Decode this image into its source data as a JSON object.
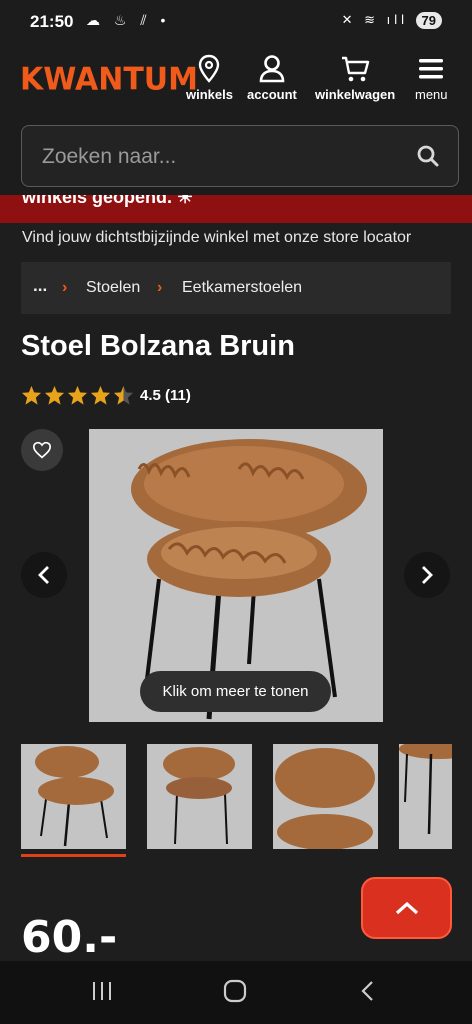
{
  "status_bar": {
    "time": "21:50",
    "battery": "79"
  },
  "header": {
    "logo": "KWANTUM",
    "nav": [
      {
        "icon": "location-pin-icon",
        "label": "winkels"
      },
      {
        "icon": "user-icon",
        "label": "account"
      },
      {
        "icon": "cart-icon",
        "label": "winkelwagen"
      },
      {
        "icon": "hamburger-menu-icon",
        "label": "menu"
      }
    ],
    "search_placeholder": "Zoeken naar...",
    "accent": "#f05a1a"
  },
  "banner": {
    "text": "winkels geopend. ☀",
    "color": "#8e1010"
  },
  "locator_text": "Vind jouw dichtstbijzijnde winkel met onze store locator",
  "breadcrumb": [
    "...",
    "Stoelen",
    "Eetkamerstoelen"
  ],
  "product": {
    "title": "Stoel Bolzana Bruin",
    "rating": 4.5,
    "rating_text": "4.5 (11)",
    "more_button": "Klik om meer te tonen",
    "price": "60.-"
  }
}
